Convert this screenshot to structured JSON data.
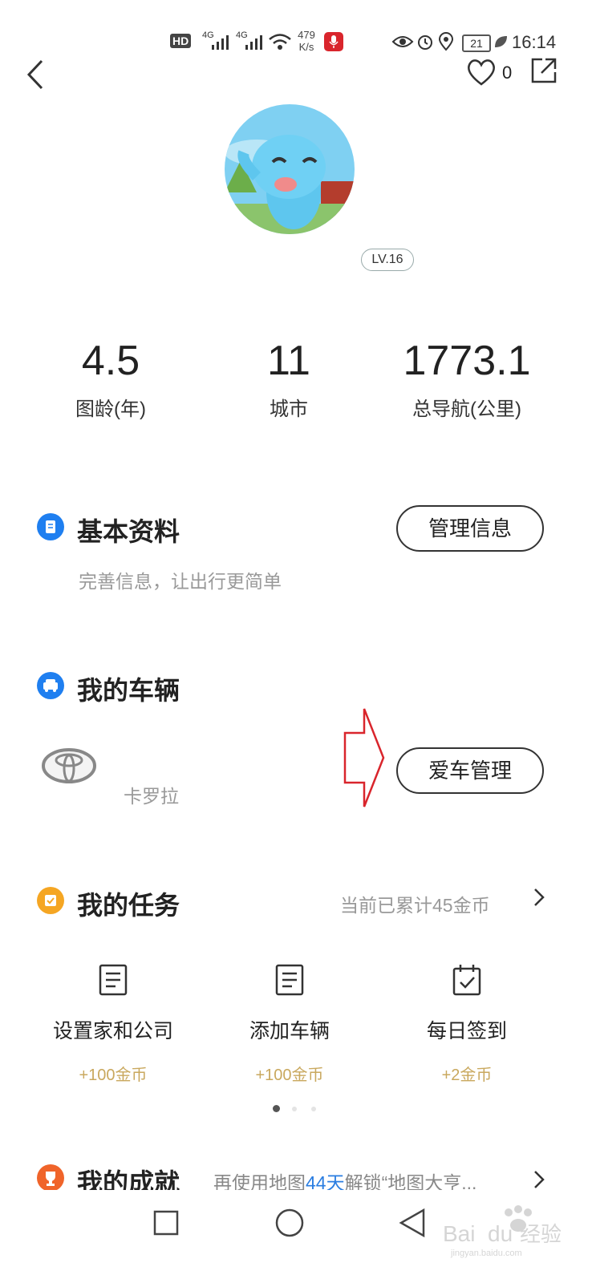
{
  "status_bar": {
    "hd": "HD",
    "net_a": "4G",
    "net_b": "4G",
    "speed_value": "479",
    "speed_unit": "K/s",
    "battery": "21",
    "time": "16:14"
  },
  "header": {
    "like_count": "0"
  },
  "profile": {
    "level": "LV.16"
  },
  "stats": [
    {
      "value": "4.5",
      "label": "图龄(年)"
    },
    {
      "value": "11",
      "label": "城市"
    },
    {
      "value": "1773.1",
      "label": "总导航(公里)"
    }
  ],
  "basic_info": {
    "title": "基本资料",
    "subtitle": "完善信息，让出行更简单",
    "button": "管理信息"
  },
  "vehicles": {
    "title": "我的车辆",
    "car_name": "卡罗拉",
    "button": "爱车管理"
  },
  "tasks": {
    "title": "我的任务",
    "summary": "当前已累计45金币",
    "items": [
      {
        "name": "设置家和公司",
        "reward": "+100金币"
      },
      {
        "name": "添加车辆",
        "reward": "+100金币"
      },
      {
        "name": "每日签到",
        "reward": "+2金币"
      }
    ]
  },
  "achievements": {
    "title": "我的成就",
    "text_prefix": "再使用地图",
    "days": "44天",
    "text_suffix": "解锁“地图大亨..."
  },
  "watermark": "Baidu经验 jingyan.baidu.com",
  "colors": {
    "icon_blue": "#1f7ff0",
    "icon_orange": "#f5a623",
    "icon_red_orange": "#f0642a",
    "reward_gold": "#c9a85e",
    "highlight_blue": "#2a7de1",
    "arrow_red": "#d9252c"
  }
}
